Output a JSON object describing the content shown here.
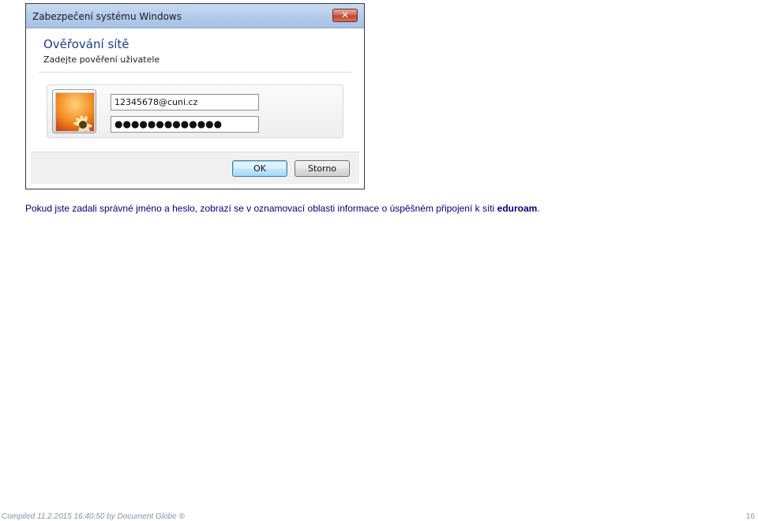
{
  "dialog": {
    "title": "Zabezpečení systému Windows",
    "close_label": "✕",
    "heading": "Ověřování sítě",
    "subheading": "Zadejte pověření uživatele",
    "username_value": "12345678@cuni.cz",
    "password_value": "●●●●●●●●●●●●●",
    "ok_label": "OK",
    "cancel_label": "Storno",
    "avatar_icon": "flower-user-tile-icon"
  },
  "caption": {
    "text_before": "Pokud jste zadali správné jméno a heslo, zobrazí se v oznamovací oblasti informace o úspěšném připojení k síti ",
    "network_name": "eduroam",
    "text_after": "."
  },
  "footer": {
    "compiled": "Compiled 11.2.2015 16:40:50 by Document Globe ®",
    "page_number": "16"
  }
}
